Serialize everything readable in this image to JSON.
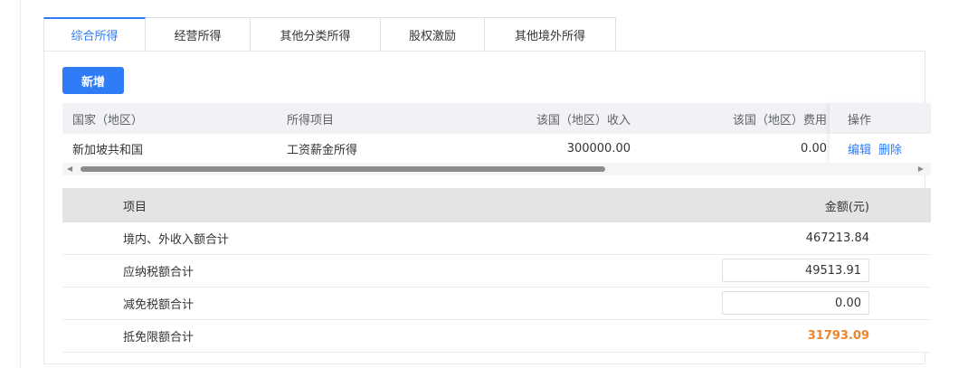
{
  "tabs": [
    {
      "label": "综合所得",
      "active": true
    },
    {
      "label": "经营所得",
      "active": false
    },
    {
      "label": "其他分类所得",
      "active": false
    },
    {
      "label": "股权激励",
      "active": false
    },
    {
      "label": "其他境外所得",
      "active": false
    }
  ],
  "toolbar": {
    "add_label": "新增"
  },
  "income_table": {
    "headers": {
      "country": "国家（地区）",
      "item": "所得项目",
      "income": "该国（地区）收入",
      "expense": "该国（地区）费用",
      "ops": "操作"
    },
    "rows": [
      {
        "country": "新加坡共和国",
        "item": "工资薪金所得",
        "income": "300000.00",
        "expense": "0.00",
        "edit": "编辑",
        "delete": "删除"
      }
    ],
    "scroll_fraction": 0.63
  },
  "summary": {
    "headers": {
      "item": "项目",
      "amount": "金额(元)"
    },
    "rows": [
      {
        "label": "境内、外收入额合计",
        "value": "467213.84"
      },
      {
        "label": "应纳税额合计",
        "value": "49513.91"
      },
      {
        "label": "减免税额合计",
        "value": "0.00"
      },
      {
        "label": "抵免限额合计",
        "value": "31793.09"
      }
    ]
  },
  "colors": {
    "accent": "#2f7cf6",
    "highlight_value": "#f0852b",
    "table_header_bg": "#f0f2f5",
    "summary_header_bg": "#e4e4e4"
  }
}
